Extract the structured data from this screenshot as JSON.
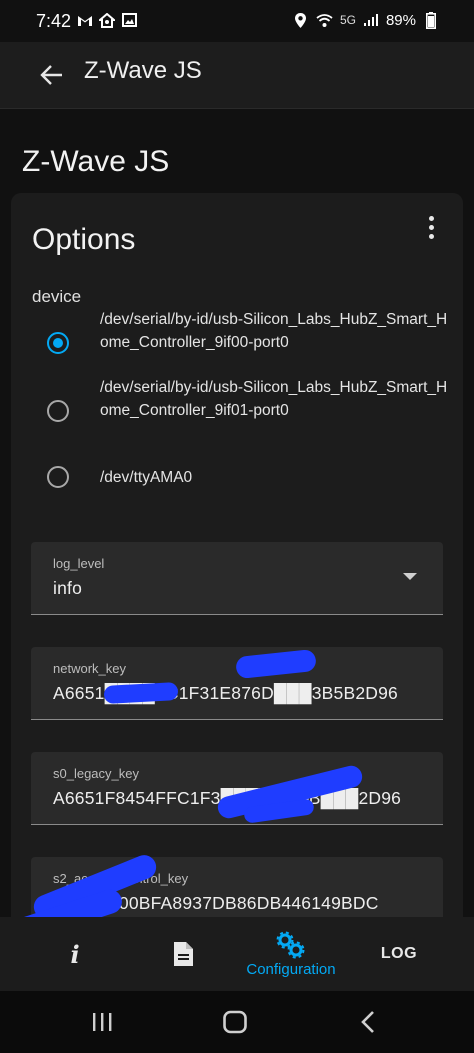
{
  "status_bar": {
    "time": "7:42",
    "network": "5G",
    "battery": "89%",
    "icons": [
      "gmail-icon",
      "smart-home-icon",
      "image-icon",
      "location-icon",
      "wifi-calling-icon",
      "signal-icon",
      "battery-icon"
    ]
  },
  "app_bar": {
    "title": "Z-Wave JS",
    "back_icon": "arrow-left-icon"
  },
  "page": {
    "title": "Z-Wave JS"
  },
  "options_card": {
    "title": "Options",
    "menu_icon": "more-vertical-icon",
    "device": {
      "label": "device",
      "options": [
        {
          "label": "/dev/serial/by-id/usb-Silicon_Labs_HubZ_Smart_Home_Controller_9if00-port0",
          "selected": true
        },
        {
          "label": "/dev/serial/by-id/usb-Silicon_Labs_HubZ_Smart_Home_Controller_9if01-port0",
          "selected": false
        },
        {
          "label": "/dev/ttyAMA0",
          "selected": false
        }
      ]
    },
    "fields": [
      {
        "label": "log_level",
        "value": "info",
        "type": "select"
      },
      {
        "label": "network_key",
        "value": "A6651████FC1F31E876D███3B5B2D96",
        "type": "text"
      },
      {
        "label": "s0_legacy_key",
        "value": "A6651F8454FFC1F3███████B███2D96",
        "type": "text"
      },
      {
        "label": "s2_access_control_key",
        "value": "0██3F800BFA8937DB86DB446149BDC",
        "type": "text"
      }
    ]
  },
  "bottom_nav": {
    "items": [
      {
        "id": "info",
        "icon": "info-icon",
        "label": ""
      },
      {
        "id": "documentation",
        "icon": "document-icon",
        "label": ""
      },
      {
        "id": "configuration",
        "icon": "cogs-icon",
        "label": "Configuration",
        "active": true
      },
      {
        "id": "log",
        "icon": "log-icon",
        "label": "LOG"
      }
    ]
  },
  "system_nav": {
    "buttons": [
      "recents-icon",
      "home-icon",
      "back-icon"
    ]
  },
  "colors": {
    "accent": "#03a9f4",
    "background": "#111111",
    "card": "#1c1c1c",
    "field": "#2a2a2a",
    "redaction": "#1f3dff"
  }
}
